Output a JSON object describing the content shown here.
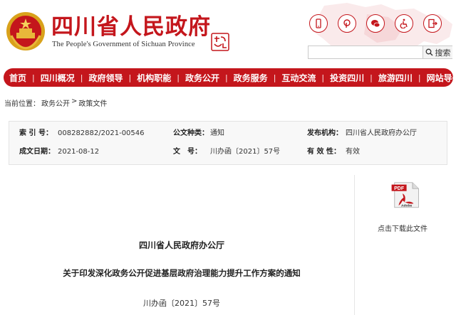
{
  "header": {
    "title": "四川省人民政府",
    "subtitle": "The People's Government of Sichuan Province"
  },
  "top_icons": [
    "mobile-icon",
    "weibo-icon",
    "wechat-icon",
    "accessibility-icon",
    "exit-icon"
  ],
  "search": {
    "placeholder": "",
    "button_label": "搜索"
  },
  "nav": {
    "items": [
      "首页",
      "四川概况",
      "政府领导",
      "机构职能",
      "政务公开",
      "政务服务",
      "互动交流",
      "投资四川",
      "旅游四川",
      "网站导航"
    ]
  },
  "breadcrumb": {
    "prefix": "当前位置：",
    "level1": "政务公开",
    "sep": ">",
    "level2": "政策文件"
  },
  "meta": {
    "index_label": "索 引 号：",
    "index_value": "008282882/2021-00546",
    "type_label": "公文种类：",
    "type_value": "通知",
    "issuer_label": "发布机构：",
    "issuer_value": "四川省人民政府办公厅",
    "date_label": "成文日期：",
    "date_value": "2021-08-12",
    "docno_label": "文　号：",
    "docno_value": "川办函〔2021〕57号",
    "validity_label": "有 效 性：",
    "validity_value": "有效"
  },
  "document": {
    "issuer": "四川省人民政府办公厅",
    "title": "关于印发深化政务公开促进基层政府治理能力提升工作方案的通知",
    "number": "川办函〔2021〕57号"
  },
  "download": {
    "icon_text": "PDF",
    "brand_text": "Adobe",
    "label": "点击下载此文件"
  },
  "colors": {
    "brand_red": "#c4161c"
  }
}
